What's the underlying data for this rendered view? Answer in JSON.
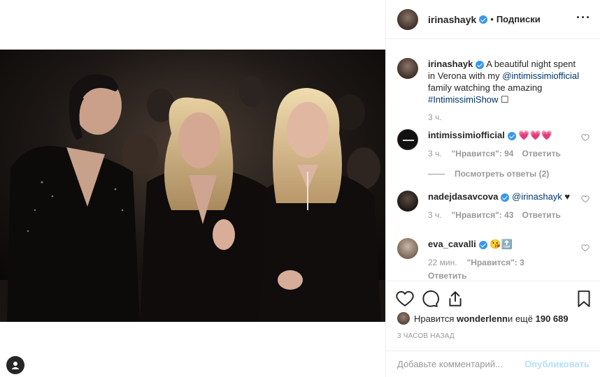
{
  "post": {
    "username": "irinashayk",
    "follow_label": "Подписки",
    "dot": "•",
    "more": "···"
  },
  "caption": {
    "username": "irinashayk",
    "text_before": " A beautiful night spent in Verona with my ",
    "mention": "@intimissimiofficial",
    "text_mid": " family watching the amazing ",
    "hashtag": "#IntimissimiShow",
    "symbol": " ☐",
    "time": "3 ч."
  },
  "comments": [
    {
      "username": "intimissimiofficial",
      "text": " 💗💗💗",
      "time": "3 ч.",
      "likes": "\"Нравится\": 94",
      "reply": "Ответить",
      "view_replies": "Посмотреть ответы (2)"
    },
    {
      "username": "nadejdasavcova",
      "mention": "@irinashayk",
      "text": " ♥",
      "time": "3 ч.",
      "likes": "\"Нравится\": 43",
      "reply": "Ответить"
    },
    {
      "username": "eva_cavalli",
      "text": " 😘🔝",
      "time": "22 мин.",
      "likes": "\"Нравится\": 3",
      "reply": "Ответить"
    }
  ],
  "likes": {
    "prefix": "Нравится ",
    "user": "wonderlenn",
    "mid": " и ещё ",
    "count": "190 689"
  },
  "time_ago": "3 ЧАСОВ НАЗАД",
  "add_comment": {
    "placeholder": "Добавьте комментарий...",
    "publish_label": "Опубликовать"
  },
  "colors": {
    "link": "#003569",
    "verified": "#3897f0",
    "publish_disabled": "#b2dffc",
    "muted": "#999999"
  },
  "icons": [
    "heart-icon",
    "comment-icon",
    "share-icon",
    "bookmark-icon",
    "more-icon",
    "profile-icon",
    "verified-icon"
  ]
}
